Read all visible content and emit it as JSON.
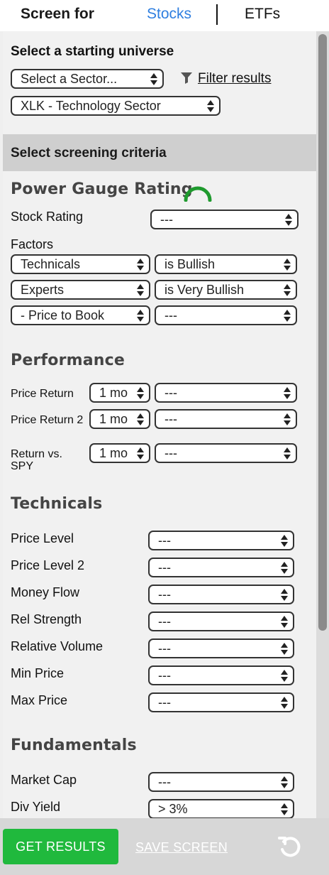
{
  "header": {
    "screen_for": "Screen for",
    "tabs": [
      {
        "label": "Stocks",
        "active": true
      },
      {
        "label": "ETFs",
        "active": false
      }
    ]
  },
  "universe": {
    "title": "Select a starting universe",
    "sector_select": "Select a Sector...",
    "filter_link": "Filter results",
    "etf_select": "XLK - Technology Sector"
  },
  "criteria_title": "Select screening criteria",
  "power_gauge": {
    "title": "Power Gauge Rating",
    "stock_rating_label": "Stock Rating",
    "stock_rating_value": "---",
    "factors_label": "Factors",
    "factors": [
      {
        "factor": "Technicals",
        "condition": "is Bullish"
      },
      {
        "factor": "Experts",
        "condition": "is Very Bullish"
      },
      {
        "factor": "- Price to Book",
        "condition": "---"
      }
    ]
  },
  "performance": {
    "title": "Performance",
    "rows": [
      {
        "label": "Price Return",
        "period": "1 mo",
        "value": "---"
      },
      {
        "label": "Price Return 2",
        "period": "1 mo",
        "value": "---"
      },
      {
        "label": "Return vs. SPY",
        "period": "1 mo",
        "value": "---"
      }
    ]
  },
  "technicals": {
    "title": "Technicals",
    "rows": [
      {
        "label": "Price Level",
        "value": "---"
      },
      {
        "label": "Price Level 2",
        "value": "---"
      },
      {
        "label": "Money Flow",
        "value": "---"
      },
      {
        "label": "Rel Strength",
        "value": "---"
      },
      {
        "label": "Relative Volume",
        "value": "---"
      },
      {
        "label": "Min Price",
        "value": "---"
      },
      {
        "label": "Max Price",
        "value": "---"
      }
    ]
  },
  "fundamentals": {
    "title": "Fundamentals",
    "rows": [
      {
        "label": "Market Cap",
        "value": "---"
      },
      {
        "label": "Div Yield",
        "value": "> 3%"
      }
    ]
  },
  "footer": {
    "get_results": "GET RESULTS",
    "save_screen": "SAVE SCREEN"
  },
  "colors": {
    "accent_blue": "#2f7fe0",
    "gauge_green": "#1f9a2e",
    "button_green": "#20b93d"
  }
}
